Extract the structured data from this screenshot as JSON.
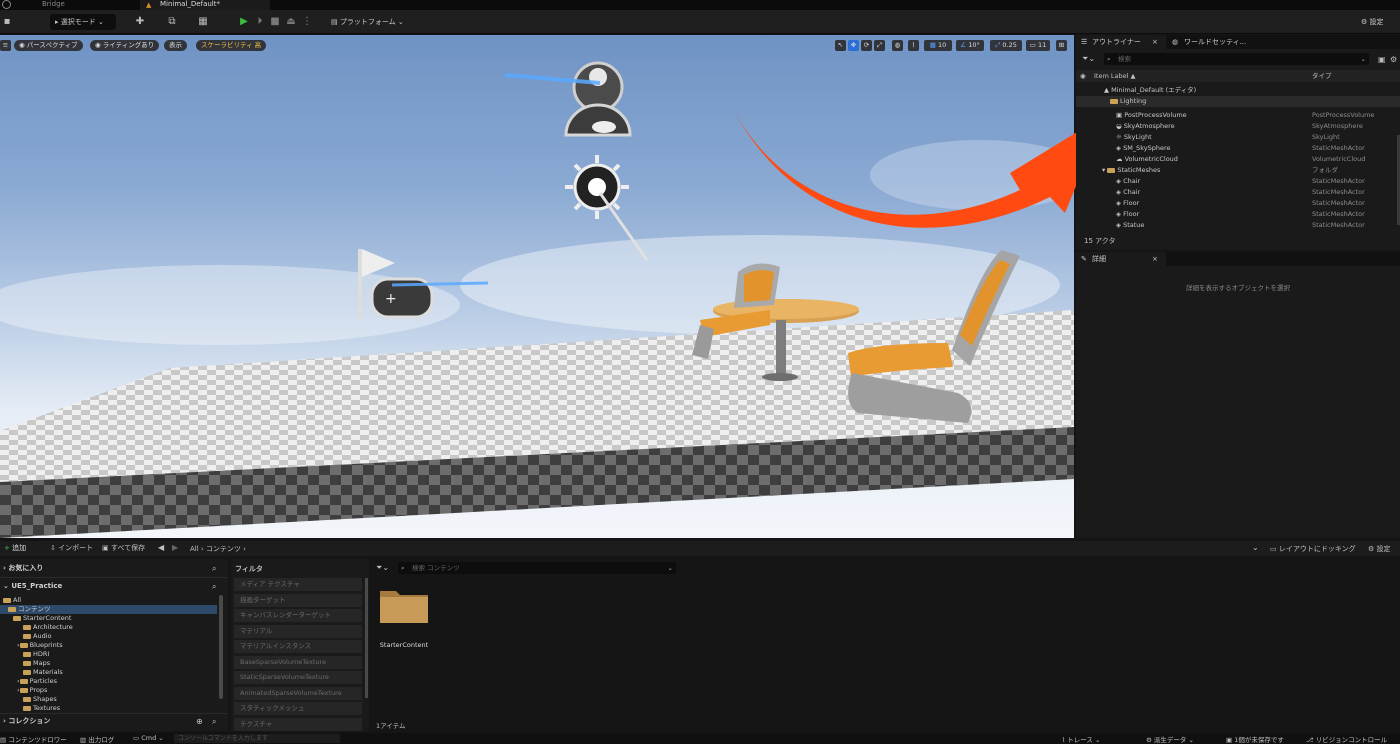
{
  "tabs": {
    "bridge": "Bridge",
    "level": "Minimal_Default*"
  },
  "toolbar": {
    "mode": "選択モード",
    "platforms": "プラットフォーム",
    "settings": "設定"
  },
  "viewport": {
    "perspective": "パースペクティブ",
    "lighting": "ライティングあり",
    "show": "表示",
    "scalability": "スケーラビリティ 高",
    "grid": "10",
    "angle": "10°",
    "scale": "0.25",
    "camera": "11"
  },
  "outliner": {
    "tab_outliner": "アウトライナー",
    "tab_world": "ワールドセッティ...",
    "search_placeholder": "検索",
    "col_label": "Item Label ▲",
    "col_type": "タイプ",
    "rows": [
      {
        "name": "Minimal_Default (エディタ)",
        "type": ""
      },
      {
        "name": "Lighting",
        "type": ""
      },
      {
        "name": "PostProcessVolume",
        "type": "PostProcessVolume"
      },
      {
        "name": "SkyAtmosphere",
        "type": "SkyAtmosphere"
      },
      {
        "name": "SkyLight",
        "type": "SkyLight"
      },
      {
        "name": "SM_SkySphere",
        "type": "StaticMeshActor"
      },
      {
        "name": "VolumetricCloud",
        "type": "VolumetricCloud"
      },
      {
        "name": "StaticMeshes",
        "type": "フォルダ"
      },
      {
        "name": "Chair",
        "type": "StaticMeshActor"
      },
      {
        "name": "Chair",
        "type": "StaticMeshActor"
      },
      {
        "name": "Floor",
        "type": "StaticMeshActor"
      },
      {
        "name": "Floor",
        "type": "StaticMeshActor"
      },
      {
        "name": "Statue",
        "type": "StaticMeshActor"
      }
    ],
    "count": "15 アクタ"
  },
  "details": {
    "tab": "詳細",
    "empty": "詳細を表示するオブジェクトを選択"
  },
  "content": {
    "add": "追加",
    "import": "インポート",
    "save_all": "すべて保存",
    "crumb_all": "All",
    "crumb_content": "コンテンツ",
    "dock": "レイアウトにドッキング",
    "settings": "設定",
    "favorites": "お気に入り",
    "project": "UE5_Practice",
    "tree": [
      "All",
      "コンテンツ",
      "StarterContent",
      "Architecture",
      "Audio",
      "Blueprints",
      "HDRI",
      "Maps",
      "Materials",
      "Particles",
      "Props",
      "Shapes",
      "Textures"
    ],
    "collections": "コレクション",
    "filter_title": "フィルタ",
    "filters": [
      "メディア テクスチャ",
      "描画ターゲット",
      "キャンバスレンダーターゲット",
      "マテリアル",
      "マテリアルインスタンス",
      "BaseSparseVolumeTexture",
      "StaticSparseVolumeTexture",
      "AnimatedSparseVolumeTexture",
      "スタティックメッシュ",
      "テクスチャ"
    ],
    "search_placeholder": "検索 コンテンツ",
    "folder_name": "StarterContent",
    "item_count": "1アイテム"
  },
  "status": {
    "drawer": "コンテンツドロワー",
    "output": "出力ログ",
    "cmd": "Cmd",
    "cmd_placeholder": "コンソールコマンドを入力します",
    "trace": "トレース",
    "derived": "派生データ",
    "unsaved": "1個が未保存です",
    "revision": "リビジョンコントロール"
  },
  "colors": {
    "accent_green": "#3fbf3f",
    "highlight_orange": "#ff4a12",
    "selection": "#2e4a6a"
  }
}
